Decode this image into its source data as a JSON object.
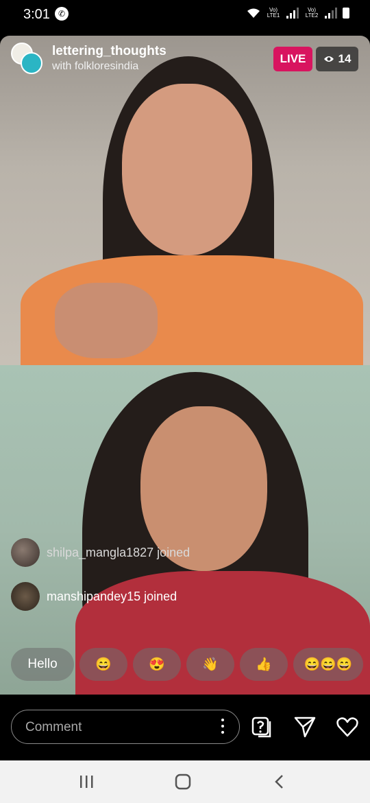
{
  "status_bar": {
    "time": "3:01",
    "sim1": "Vo) LTE1",
    "sim2": "Vo) LTE2"
  },
  "live": {
    "host": "lettering_thoughts",
    "guest_line": "with folkloresindia",
    "live_label": "LIVE",
    "viewer_count": "14"
  },
  "joins": [
    {
      "text": "shilpa_mangla1827 joined"
    },
    {
      "text": "manshipandey15 joined"
    }
  ],
  "quick_replies": [
    "Hello",
    "😄",
    "😍",
    "👋",
    "👍",
    "😄😄😄"
  ],
  "comment": {
    "placeholder": "Comment"
  },
  "colors": {
    "live_badge": "#d8145f",
    "nav_bar": "#f2f2f2"
  }
}
